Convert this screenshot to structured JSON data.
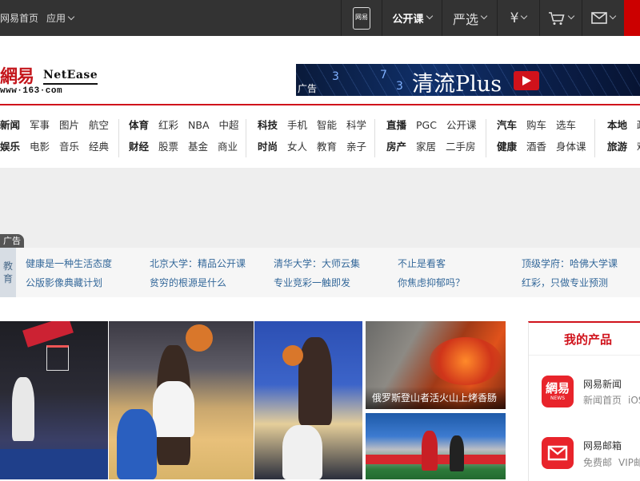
{
  "topbar": {
    "home": "网易首页",
    "apps": "应用",
    "phone_label": "网易",
    "open_course": "公开课",
    "yanxuan": "严选",
    "yen": "¥",
    "colors": {
      "bg": "#333333",
      "accent": "#cc0000"
    }
  },
  "logo": {
    "cn": "網易",
    "en": "NetEase",
    "url": "www·163·com"
  },
  "top_ad": {
    "label": "广告",
    "nums": [
      "3",
      "7",
      "3"
    ],
    "title": "清流Plus"
  },
  "nav": {
    "groups": [
      {
        "rows": [
          [
            "新闻",
            "军事",
            "图片",
            "航空"
          ],
          [
            "娱乐",
            "电影",
            "音乐",
            "经典"
          ]
        ]
      },
      {
        "rows": [
          [
            "体育",
            "红彩",
            "NBA",
            "中超"
          ],
          [
            "财经",
            "股票",
            "基金",
            "商业"
          ]
        ]
      },
      {
        "rows": [
          [
            "科技",
            "手机",
            "智能",
            "科学"
          ],
          [
            "时尚",
            "女人",
            "教育",
            "亲子"
          ]
        ]
      },
      {
        "rows": [
          [
            "直播",
            "PGC",
            "公开课"
          ],
          [
            "房产",
            "家居",
            "二手房"
          ]
        ]
      },
      {
        "rows": [
          [
            "汽车",
            "购车",
            "选车"
          ],
          [
            "健康",
            "酒香",
            "身体课"
          ]
        ]
      },
      {
        "rows": [
          [
            "本地",
            "政"
          ],
          [
            "旅游",
            "难"
          ]
        ]
      }
    ]
  },
  "ad_tag": "广告",
  "edu": {
    "tag": [
      "教",
      "育"
    ],
    "links": [
      "健康是一种生活态度",
      "公版影像典藏计划",
      "北京大学：精品公开课",
      "贫穷的根源是什么",
      "清华大学：大师云集",
      "专业竞彩一触即发",
      "不止是看客",
      "你焦虑抑郁吗？",
      "顶级学府：哈佛大学课",
      "红彩，只做专业预测"
    ]
  },
  "photos": {
    "caption_volcano": "俄罗斯登山者活火山上烤香肠"
  },
  "products": {
    "title": "我的产品",
    "items": [
      {
        "name": "网易新闻",
        "icon_text": "網易",
        "icon_sub": "NEWS",
        "links": [
          "新闻首页",
          "iOS"
        ]
      },
      {
        "name": "网易邮箱",
        "icon": "mail-icon",
        "links": [
          "免费邮",
          "VIP邮"
        ]
      }
    ]
  }
}
